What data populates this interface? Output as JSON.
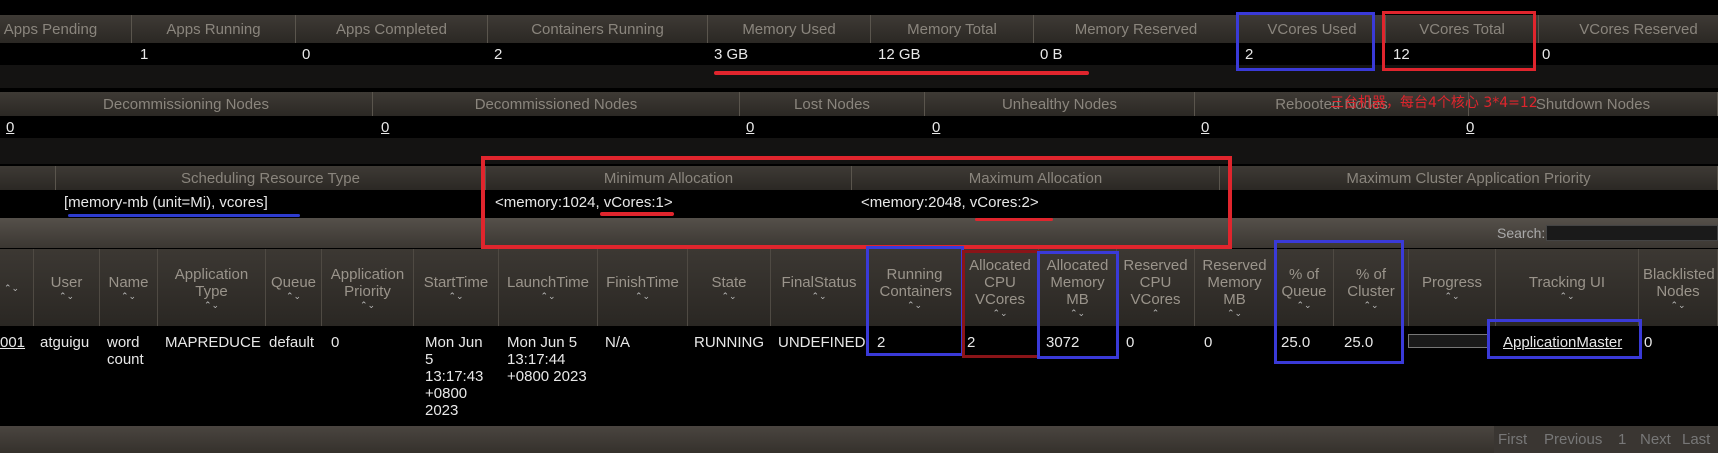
{
  "cluster_metrics": {
    "headers": [
      "Apps Pending",
      "Apps Running",
      "Apps Completed",
      "Containers Running",
      "Memory Used",
      "Memory Total",
      "Memory Reserved",
      "VCores Used",
      "VCores Total",
      "VCores Reserved"
    ],
    "values": [
      "",
      "1",
      "0",
      "2",
      "3 GB",
      "12 GB",
      "0 B",
      "2",
      "12",
      "0"
    ]
  },
  "node_metrics": {
    "headers": [
      "Decommissioning Nodes",
      "Decommissioned Nodes",
      "Lost Nodes",
      "Unhealthy Nodes",
      "Rebooted Nodes",
      "Shutdown Nodes"
    ],
    "values": [
      "0",
      "0",
      "0",
      "0",
      "0",
      "0"
    ]
  },
  "annotation_note": "三台机器，每台4个核心 3*4=12",
  "scheduler": {
    "headers": [
      "Scheduling Resource Type",
      "Minimum Allocation",
      "Maximum Allocation",
      "Maximum Cluster Application Priority"
    ],
    "values": [
      "[memory-mb (unit=Mi), vcores]",
      "<memory:1024, vCores:1>",
      "<memory:2048, vCores:2>",
      ""
    ]
  },
  "search": {
    "label": "Search:",
    "value": ""
  },
  "apps_table": {
    "columns": [
      {
        "label": "",
        "sort": true
      },
      {
        "label": "User",
        "sort": true
      },
      {
        "label": "Name",
        "sort": true
      },
      {
        "label": "Application Type",
        "sort": true
      },
      {
        "label": "Queue",
        "sort": true
      },
      {
        "label": "Application Priority",
        "sort": true
      },
      {
        "label": "StartTime",
        "sort": true
      },
      {
        "label": "LaunchTime",
        "sort": true
      },
      {
        "label": "FinishTime",
        "sort": true
      },
      {
        "label": "State",
        "sort": true
      },
      {
        "label": "FinalStatus",
        "sort": true
      },
      {
        "label": "Running Containers",
        "sort": true
      },
      {
        "label": "Allocated CPU VCores",
        "sort": true
      },
      {
        "label": "Allocated Memory MB",
        "sort": true
      },
      {
        "label": "Reserved CPU VCores",
        "sort": true
      },
      {
        "label": "Reserved Memory MB",
        "sort": true
      },
      {
        "label": "% of Queue",
        "sort": true
      },
      {
        "label": "% of Cluster",
        "sort": true
      },
      {
        "label": "Progress",
        "sort": true
      },
      {
        "label": "Tracking UI",
        "sort": true
      },
      {
        "label": "Blacklisted Nodes",
        "sort": true
      }
    ],
    "row": {
      "id": "001",
      "user": "atguigu",
      "name": "word count",
      "type": "MAPREDUCE",
      "queue": "default",
      "priority": "0",
      "start_time": "Mon Jun 5 13:17:43 +0800 2023",
      "launch_time": "Mon Jun 5 13:17:44 +0800 2023",
      "finish_time": "N/A",
      "state": "RUNNING",
      "final_status": "UNDEFINED",
      "running_containers": "2",
      "allocated_vcores": "2",
      "allocated_memory": "3072",
      "reserved_vcores": "0",
      "reserved_memory": "0",
      "pct_queue": "25.0",
      "pct_cluster": "25.0",
      "progress": 0,
      "tracking_ui": "ApplicationMaster",
      "blacklisted": "0"
    }
  },
  "pagination": [
    "First",
    "Previous",
    "1",
    "Next",
    "Last"
  ],
  "colors": {
    "annotation_red": "#e0252d",
    "annotation_blue": "#3a3ad8"
  }
}
